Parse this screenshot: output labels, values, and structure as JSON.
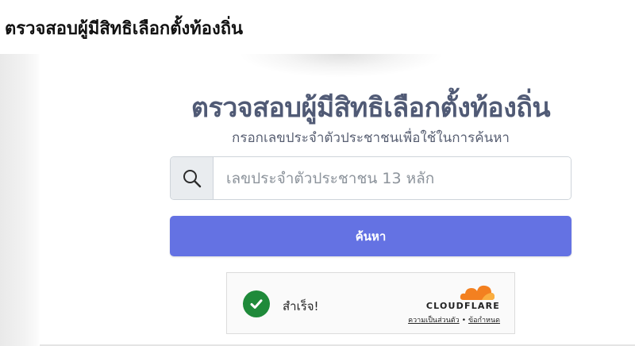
{
  "page": {
    "outer_title": "ตรวจสอบผู้มีสิทธิเลือกตั้งท้องถิ่น"
  },
  "form": {
    "headline": "ตรวจสอบผู้มีสิทธิเลือกตั้งท้องถิ่น",
    "subtitle": "กรอกเลขประจำตัวประชาชนเพื่อใช้ในการค้นหา",
    "search": {
      "icon": "search-icon",
      "value": "",
      "placeholder": "เลขประจำตัวประชาชน 13 หลัก"
    },
    "submit_label": "ค้นหา",
    "accent_color": "#6472e3"
  },
  "turnstile": {
    "status": "สำเร็จ!",
    "status_icon": "check-circle-icon",
    "status_color": "#1f8a3a",
    "brand": "CLOUDFLARE",
    "brand_icon": "cloudflare-cloud-icon",
    "brand_color": "#f38020",
    "privacy_link": "ความเป็นส่วนตัว",
    "separator": "•",
    "terms_link": "ข้อกำหนด"
  }
}
